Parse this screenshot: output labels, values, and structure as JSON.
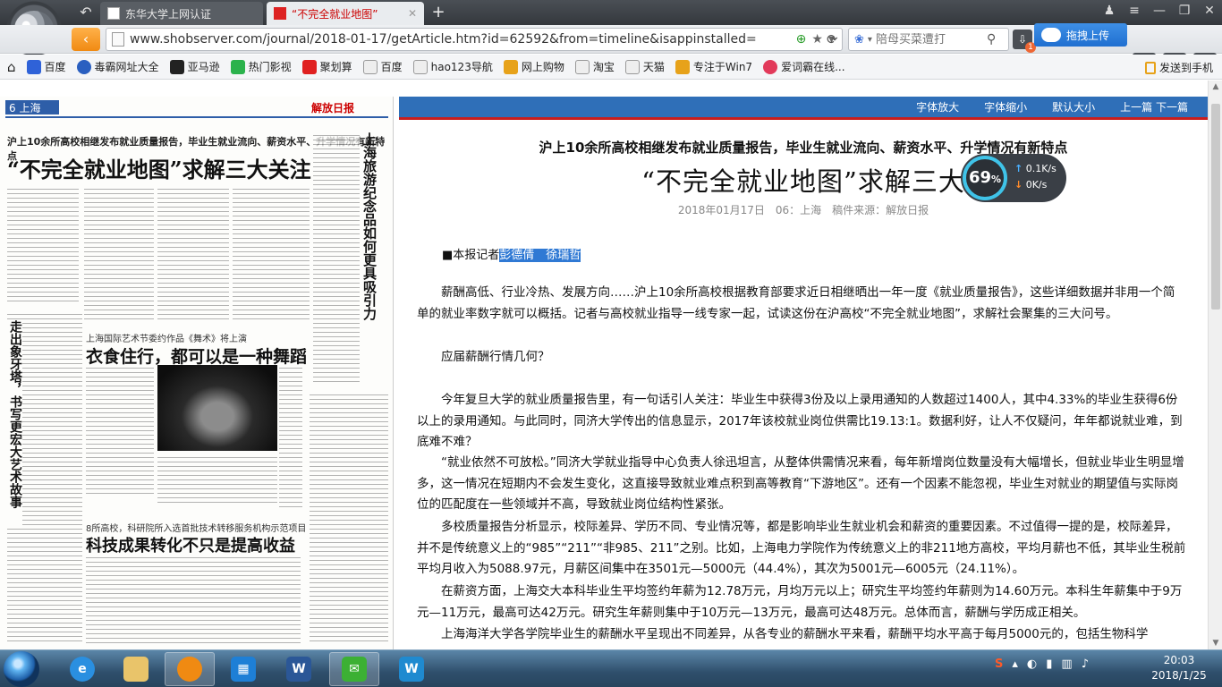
{
  "browser": {
    "tabs": [
      {
        "label": "东华大学上网认证",
        "active": false
      },
      {
        "label": "“不完全就业地图”",
        "active": true
      }
    ],
    "url": "www.shobserver.com/journal/2018-01-17/getArticle.htm?id=62592&from=timeline&isappinstalled=",
    "search_placeholder": "陪母买菜遭打",
    "upload_label": "拖拽上传",
    "notify_badge": "1"
  },
  "bookmarks": {
    "items": [
      "百度",
      "毒霸网址大全",
      "亚马逊",
      "热门影视",
      "聚划算",
      "百度",
      "hao123导航",
      "网上购物",
      "淘宝",
      "天猫",
      "专注于Win7",
      "爱词霸在线..."
    ],
    "send_to_phone": "发送到手机"
  },
  "newspaper": {
    "page_label": "6 上海",
    "masthead": "解放日报",
    "kicker": "沪上10余所高校相继发布就业质量报告，毕业生就业流向、薪资水平、升学情况有新特点",
    "headline": "“不完全就业地图”求解三大关注",
    "vertical_title_1": "上海旅游纪念品如何更具吸引力",
    "vertical_title_2": "走出象牙塔，书写更宏大艺术故事",
    "box_kicker": "上海国际艺术节委约作品《舞术》将上演",
    "box_title": "衣食住行，都可以是一种舞蹈",
    "bottom_kicker": "8所高校，科研院所入选首批技术转移服务机构示范项目",
    "bottom_title": "科技成果转化不只是提高收益"
  },
  "reader": {
    "toolbar": [
      "字体放大",
      "字体缩小",
      "默认大小",
      "上一篇 下一篇"
    ],
    "subtitle": "沪上10余所高校相继发布就业质量报告，毕业生就业流向、薪资水平、升学情况有新特点",
    "title": "“不完全就业地图”求解三大",
    "meta": "2018年01月17日　06：上海　稿件来源：解放日报",
    "reporter_prefix": "■本报记者",
    "reporter_names": "彭德倩　徐瑞哲",
    "paragraphs": [
      "薪酬高低、行业冷热、发展方向……沪上10余所高校根据教育部要求近日相继晒出一年一度《就业质量报告》，这些详细数据并非用一个简单的就业率数字就可以概括。记者与高校就业指导一线专家一起，试读这份在沪高校“不完全就业地图”，求解社会聚集的三大问号。",
      "应届薪酬行情几何？",
      "今年复旦大学的就业质量报告里，有一句话引人关注：毕业生中获得3份及以上录用通知的人数超过1400人，其中4.33%的毕业生获得6份以上的录用通知。与此同时，同济大学传出的信息显示，2017年该校就业岗位供需比19.13:1。数据利好，让人不仅疑问，年年都说就业难，到底难不难？",
      "“就业依然不可放松。”同济大学就业指导中心负责人徐迅坦言，从整体供需情况来看，每年新增岗位数量没有大幅增长，但就业毕业生明显增多，这一情况在短期内不会发生变化，这直接导致就业难点积到高等教育“下游地区”。还有一个因素不能忽视，毕业生对就业的期望值与实际岗位的匹配度在一些领域并不高，导致就业岗位结构性紧张。",
      "多校质量报告分析显示，校际差异、学历不同、专业情况等，都是影响毕业生就业机会和薪资的重要因素。不过值得一提的是，校际差异，并不是传统意义上的“985”“211”“非985、211”之别。比如，上海电力学院作为传统意义上的非211地方高校，平均月薪也不低，其毕业生税前平均月收入为5088.97元，月薪区间集中在3501元—5000元（44.4%），其次为5001元—6005元（24.11%）。",
      "在薪资方面，上海交大本科毕业生平均签约年薪为12.78万元，月均万元以上；研究生平均签约年薪则为14.60万元。本科生年薪集中于9万元—11万元，最高可达42万元。研究生年薪则集中于10万元—13万元，最高可达48万元。总体而言，薪酬与学历成正相关。",
      "上海海洋大学各学院毕业生的薪酬水平呈现出不同差异，从各专业的薪酬水平来看，薪酬平均水平高于每月5000元的，包括生物科学"
    ]
  },
  "speed_widget": {
    "percent": "69",
    "unit": "%",
    "up": "0.1K/s",
    "down": "0K/s"
  },
  "taskbar": {
    "time": "20:03",
    "date": "2018/1/25"
  }
}
